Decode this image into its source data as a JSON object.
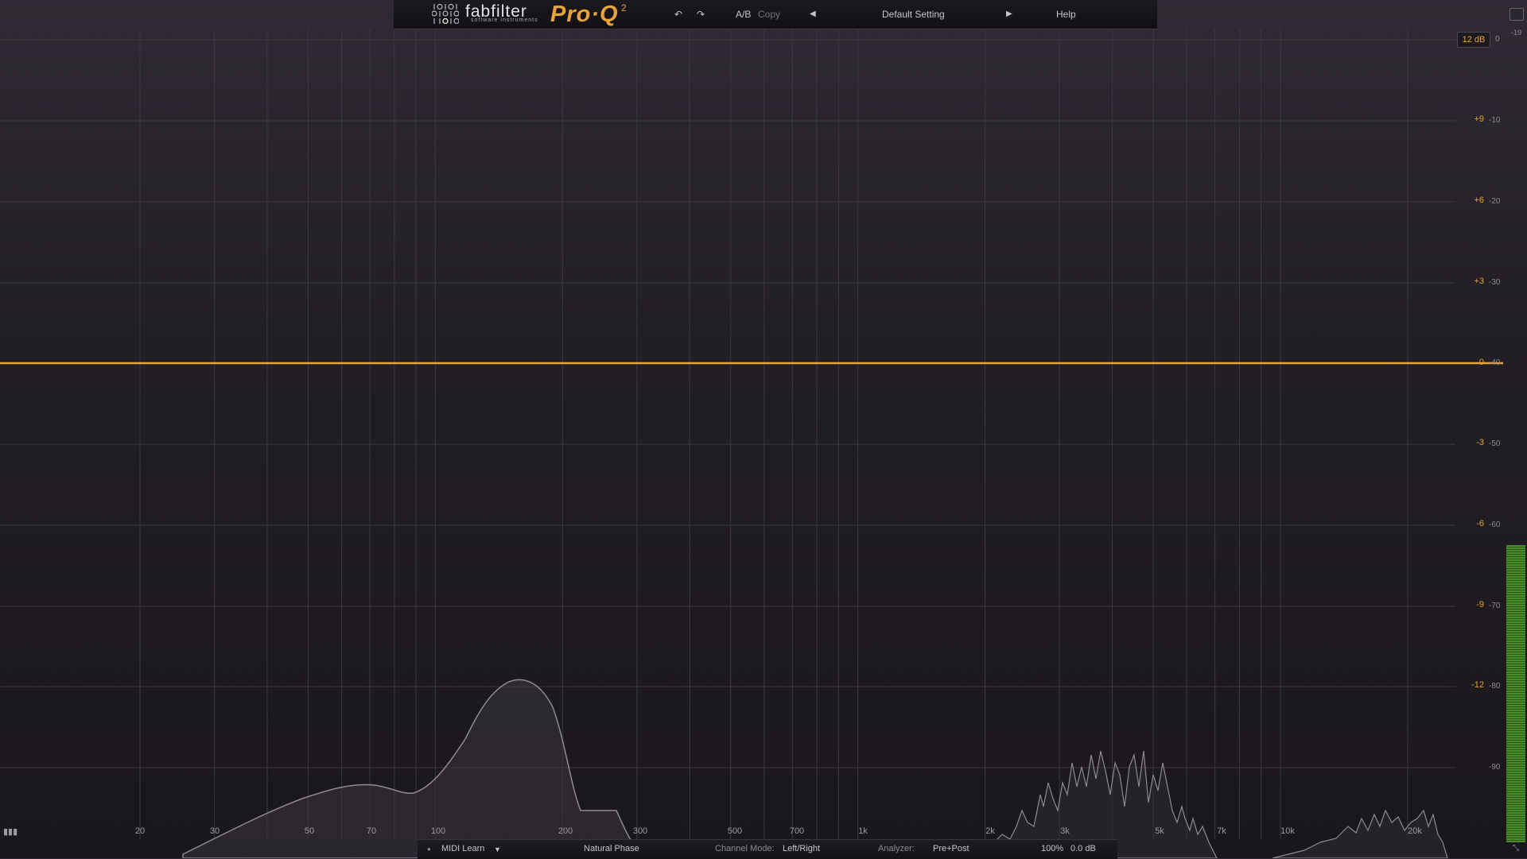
{
  "header": {
    "brand": "fabfilter",
    "brand_sub": "software instruments",
    "product": "Pro·Q",
    "product_sup": "2",
    "ab_label": "A/B",
    "copy_label": "Copy",
    "preset_name": "Default Setting",
    "help_label": "Help"
  },
  "display": {
    "range_label": "12 dB",
    "gain_scale": [
      "+9",
      "+6",
      "+3",
      "0",
      "-3",
      "-6",
      "-9",
      "-12"
    ],
    "analyzer_scale": [
      "0",
      "-10",
      "-20",
      "-30",
      "-40",
      "-50",
      "-60",
      "-70",
      "-80",
      "-90"
    ],
    "meter_top_label": "-19",
    "freq_labels": [
      "20",
      "30",
      "50",
      "70",
      "100",
      "200",
      "300",
      "500",
      "700",
      "1k",
      "2k",
      "3k",
      "5k",
      "7k",
      "10k",
      "20k"
    ],
    "eq_curve_gain_db": 0
  },
  "footer": {
    "midi_learn": "MIDI Learn",
    "phase_mode": "Natural Phase",
    "channel_mode_label": "Channel Mode:",
    "channel_mode_value": "Left/Right",
    "analyzer_label": "Analyzer:",
    "analyzer_value": "Pre+Post",
    "zoom": "100%",
    "output_gain": "0.0 dB"
  },
  "colors": {
    "accent": "#e8a43a",
    "curve": "#e8a43a",
    "meter": "#4e9a2c"
  }
}
